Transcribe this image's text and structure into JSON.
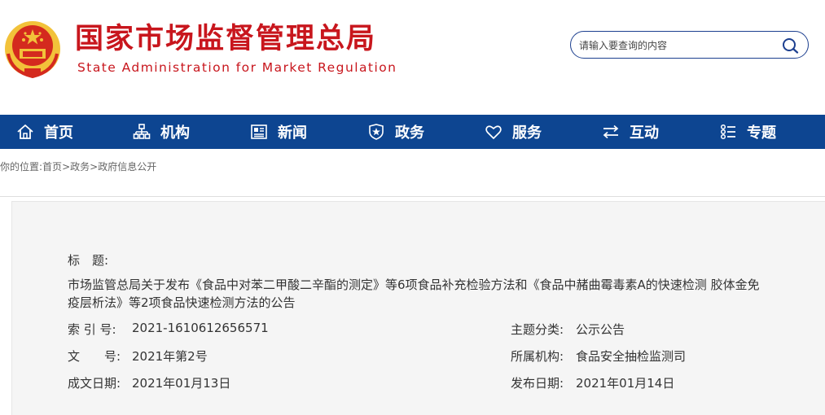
{
  "header": {
    "title": "国家市场监督管理总局",
    "subtitle": "State Administration for Market Regulation",
    "search_placeholder": "请输入要查询的内容"
  },
  "colors": {
    "brand_red": "#c8161d",
    "nav_blue": "#0d4591",
    "emblem_gold": "#f2c23a"
  },
  "nav": {
    "items": [
      {
        "label": "首页",
        "icon": "home-icon"
      },
      {
        "label": "机构",
        "icon": "org-chart-icon"
      },
      {
        "label": "新闻",
        "icon": "newspaper-icon"
      },
      {
        "label": "政务",
        "icon": "shield-icon"
      },
      {
        "label": "服务",
        "icon": "heart-icon"
      },
      {
        "label": "互动",
        "icon": "exchange-arrows-icon"
      },
      {
        "label": "专题",
        "icon": "list-icon"
      }
    ]
  },
  "breadcrumb": {
    "prefix": "你的位置:",
    "items": [
      "首页",
      "政务",
      "政府信息公开"
    ],
    "separator": ">"
  },
  "doc": {
    "title_label": "标　题:",
    "title": "市场监管总局关于发布《食品中对苯二甲酸二辛酯的测定》等6项食品补充检验方法和《食品中赭曲霉毒素A的快速检测 胶体金免疫层析法》等2项食品快速检测方法的公告",
    "index_label": "索 引 号:",
    "index_value": "2021-1610612656571",
    "topic_label": "主题分类:",
    "topic_value": "公示公告",
    "docno_label": "文　　号:",
    "docno_value": "2021年第2号",
    "org_label": "所属机构:",
    "org_value": "食品安全抽检监测司",
    "created_label": "成文日期:",
    "created_value": "2021年01月13日",
    "published_label": "发布日期:",
    "published_value": "2021年01月14日"
  }
}
